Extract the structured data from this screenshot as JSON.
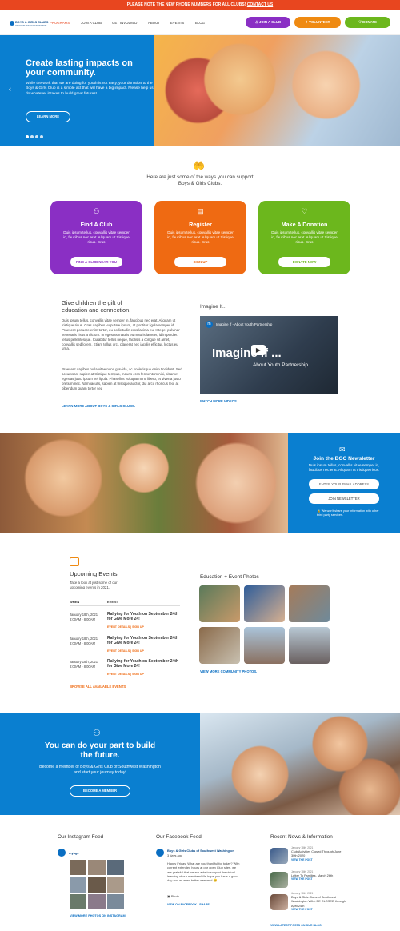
{
  "topbar": {
    "text": "PLEASE NOTE THE NEW PHONE NUMBERS FOR ALL CLUBS!",
    "link": "CONTACT US"
  },
  "logo": {
    "line1": "BOYS & GIRLS CLUBS",
    "line2": "OF SOUTHWEST WASHINGTON"
  },
  "nav": [
    "PROGRAMS",
    "JOIN A CLUB",
    "GET INVOLVED",
    "ABOUT",
    "EVENTS",
    "BLOG"
  ],
  "header_buttons": {
    "join": "JOIN A CLUB",
    "volunteer": "VOLUNTEER",
    "donate": "DONATE"
  },
  "hero": {
    "title": "Create lasting impacts on your community.",
    "text": "While the work that we are doing for youth is not easy, your donation to the Boys & Girls Club is a simple act that will have a big impact. Please help us do whatever it takes to build great futures!",
    "button": "LEARN MORE"
  },
  "support": {
    "intro": "Here are just some of the ways you can support Boys & Girls Clubs."
  },
  "cards": [
    {
      "title": "Find A Club",
      "text": "Duis ipsum tellus, convallis vitae semper in, faucibus nec erat. Aliquam ut tristique risus. Cras",
      "button": "FIND A CLUB NEAR YOU",
      "color": "#8a2fc4"
    },
    {
      "title": "Register",
      "text": "Duis ipsum tellus, convallis vitae semper in, faucibus nec erat. Aliquam ut tristique risus. Cras",
      "button": "SIGN UP",
      "color": "#ef6a12"
    },
    {
      "title": "Make A Donation",
      "text": "Duis ipsum tellus, convallis vitae semper in, faucibus nec erat. Aliquam ut tristique risus. Cras",
      "button": "DONATE NOW",
      "color": "#6cb71d"
    }
  ],
  "education": {
    "title": "Give children the gift of education and connection.",
    "p1": "Duis ipsum tellus, convallis vitae semper in, faucibus nec erat. Aliquam ut tristique risus. Cras dapibus vulputate ipsum, at porttitor ligula semper id. Praesent posuere enim tortor, eu sollicitudin eros lacinia eu. Integer pulvinar venenatis risus a dictum. In egestas mauris eu mauris laoreet, id imperdiet tellus pellentesque. Curabitur tellus neque, facilisis a congue sit amet, convallis sed lorem. Etiam tellus orci, placerat nec iaculis efficitur, luctus eu urna.",
    "p2": "Praesent dapibus nulla vitae nunc gravida, ac scelerisque enim tincidunt. Sed accumsan, sapien at tristique tempus, mauris eros fermentum nisi, sit amet egestas justo ipsum vel ligula. Phasellus volutpat nunc libero, et viverra justo pretium nec. Nam iaculis, sapien at tristique auctor, dui arcu rhoncus leo, at bibendum quam tortor sed",
    "link": "LEARN MORE ABOUT BOYS & GIRLS CLUBS."
  },
  "video": {
    "heading": "Imagine If...",
    "bar": "Imagine If - About Youth Partnership",
    "big": "Imagine if ...",
    "sub": "About Youth Partnership",
    "link": "WATCH MORE VIDEOS"
  },
  "newsletter": {
    "title": "Join the BGC Newsletter",
    "text": "Duis ipsum tellus, convallis vitae semper in, faucibus nec erat. Aliquam ut tristique risus.",
    "placeholder": "ENTER YOUR EMAIL ADDRESS",
    "button": "JOIN NEWSLETTER",
    "note": "We won't share your information with other third party services."
  },
  "events": {
    "title": "Upcoming Events",
    "intro": "Take a look at just some of our upcoming events in 2021.",
    "col_when": "WHEN",
    "col_event": "EVENT",
    "rows": [
      {
        "date": "January 18th, 2021",
        "time": "8:00AM - 8:00AM",
        "name": "Rallying for Youth on September 24th for Give More 24!",
        "links": "EVENT DETAILS | SIGN UP"
      },
      {
        "date": "January 18th, 2021",
        "time": "8:00AM - 8:00AM",
        "name": "Rallying for Youth on September 24th for Give More 24!",
        "links": "EVENT DETAILS | SIGN UP"
      },
      {
        "date": "January 18th, 2021",
        "time": "8:00AM - 8:00AM",
        "name": "Rallying for Youth on September 24th for Give More 24!",
        "links": "EVENT DETAILS | SIGN UP"
      }
    ],
    "link": "BROWSE ALL AVAILABLE EVENTS."
  },
  "photos": {
    "title": "Education + Event Photos",
    "link": "VIEW MORE COMMUNITY PHOTOS."
  },
  "cta": {
    "title": "You can do your part to build the future.",
    "text": "Become a member of Boys & Girls Club of Southwest Washington and start your journey today!",
    "button": "BECOME A MEMBER"
  },
  "instagram": {
    "title": "Our Instagram Feed",
    "handle": "mybgc",
    "link": "VIEW MORE PHOTOS ON INSTAGRAM"
  },
  "facebook": {
    "title": "Our Facebook Feed",
    "name": "Boys & Girls Clubs of Southwest Washington",
    "ago": "3 days ago",
    "text": "Happy Friday! What are you thankful for today? With current extended hours at our open Club sites, we are grateful that we are able to support the virtual learning of our members!We hope you have a good day and an even better weekend 😊",
    "photo": "Photo",
    "links": "VIEW ON FACEBOOK · SHARE"
  },
  "news": {
    "title": "Recent News & Information",
    "items": [
      {
        "date": "January 18th, 2021",
        "title": "Club Activities Closed Through June 30th 2020",
        "link": "VIEW THE POST"
      },
      {
        "date": "January 18th, 2021",
        "title": "Letter To Families, March 26th",
        "link": "VIEW THE POST"
      },
      {
        "date": "January 18th, 2021",
        "title": "Boys & Girls Clubs of Southwest Washington WILL BE CLOSED through April 24th",
        "link": "VIEW THE POST"
      }
    ],
    "link": "VIEW LATEST POSTS ON OUR BLOG."
  },
  "colors": {
    "blue": "#0a7fd0",
    "orange": "#ef6a12",
    "green": "#6cb71d",
    "purple": "#8a2fc4"
  }
}
